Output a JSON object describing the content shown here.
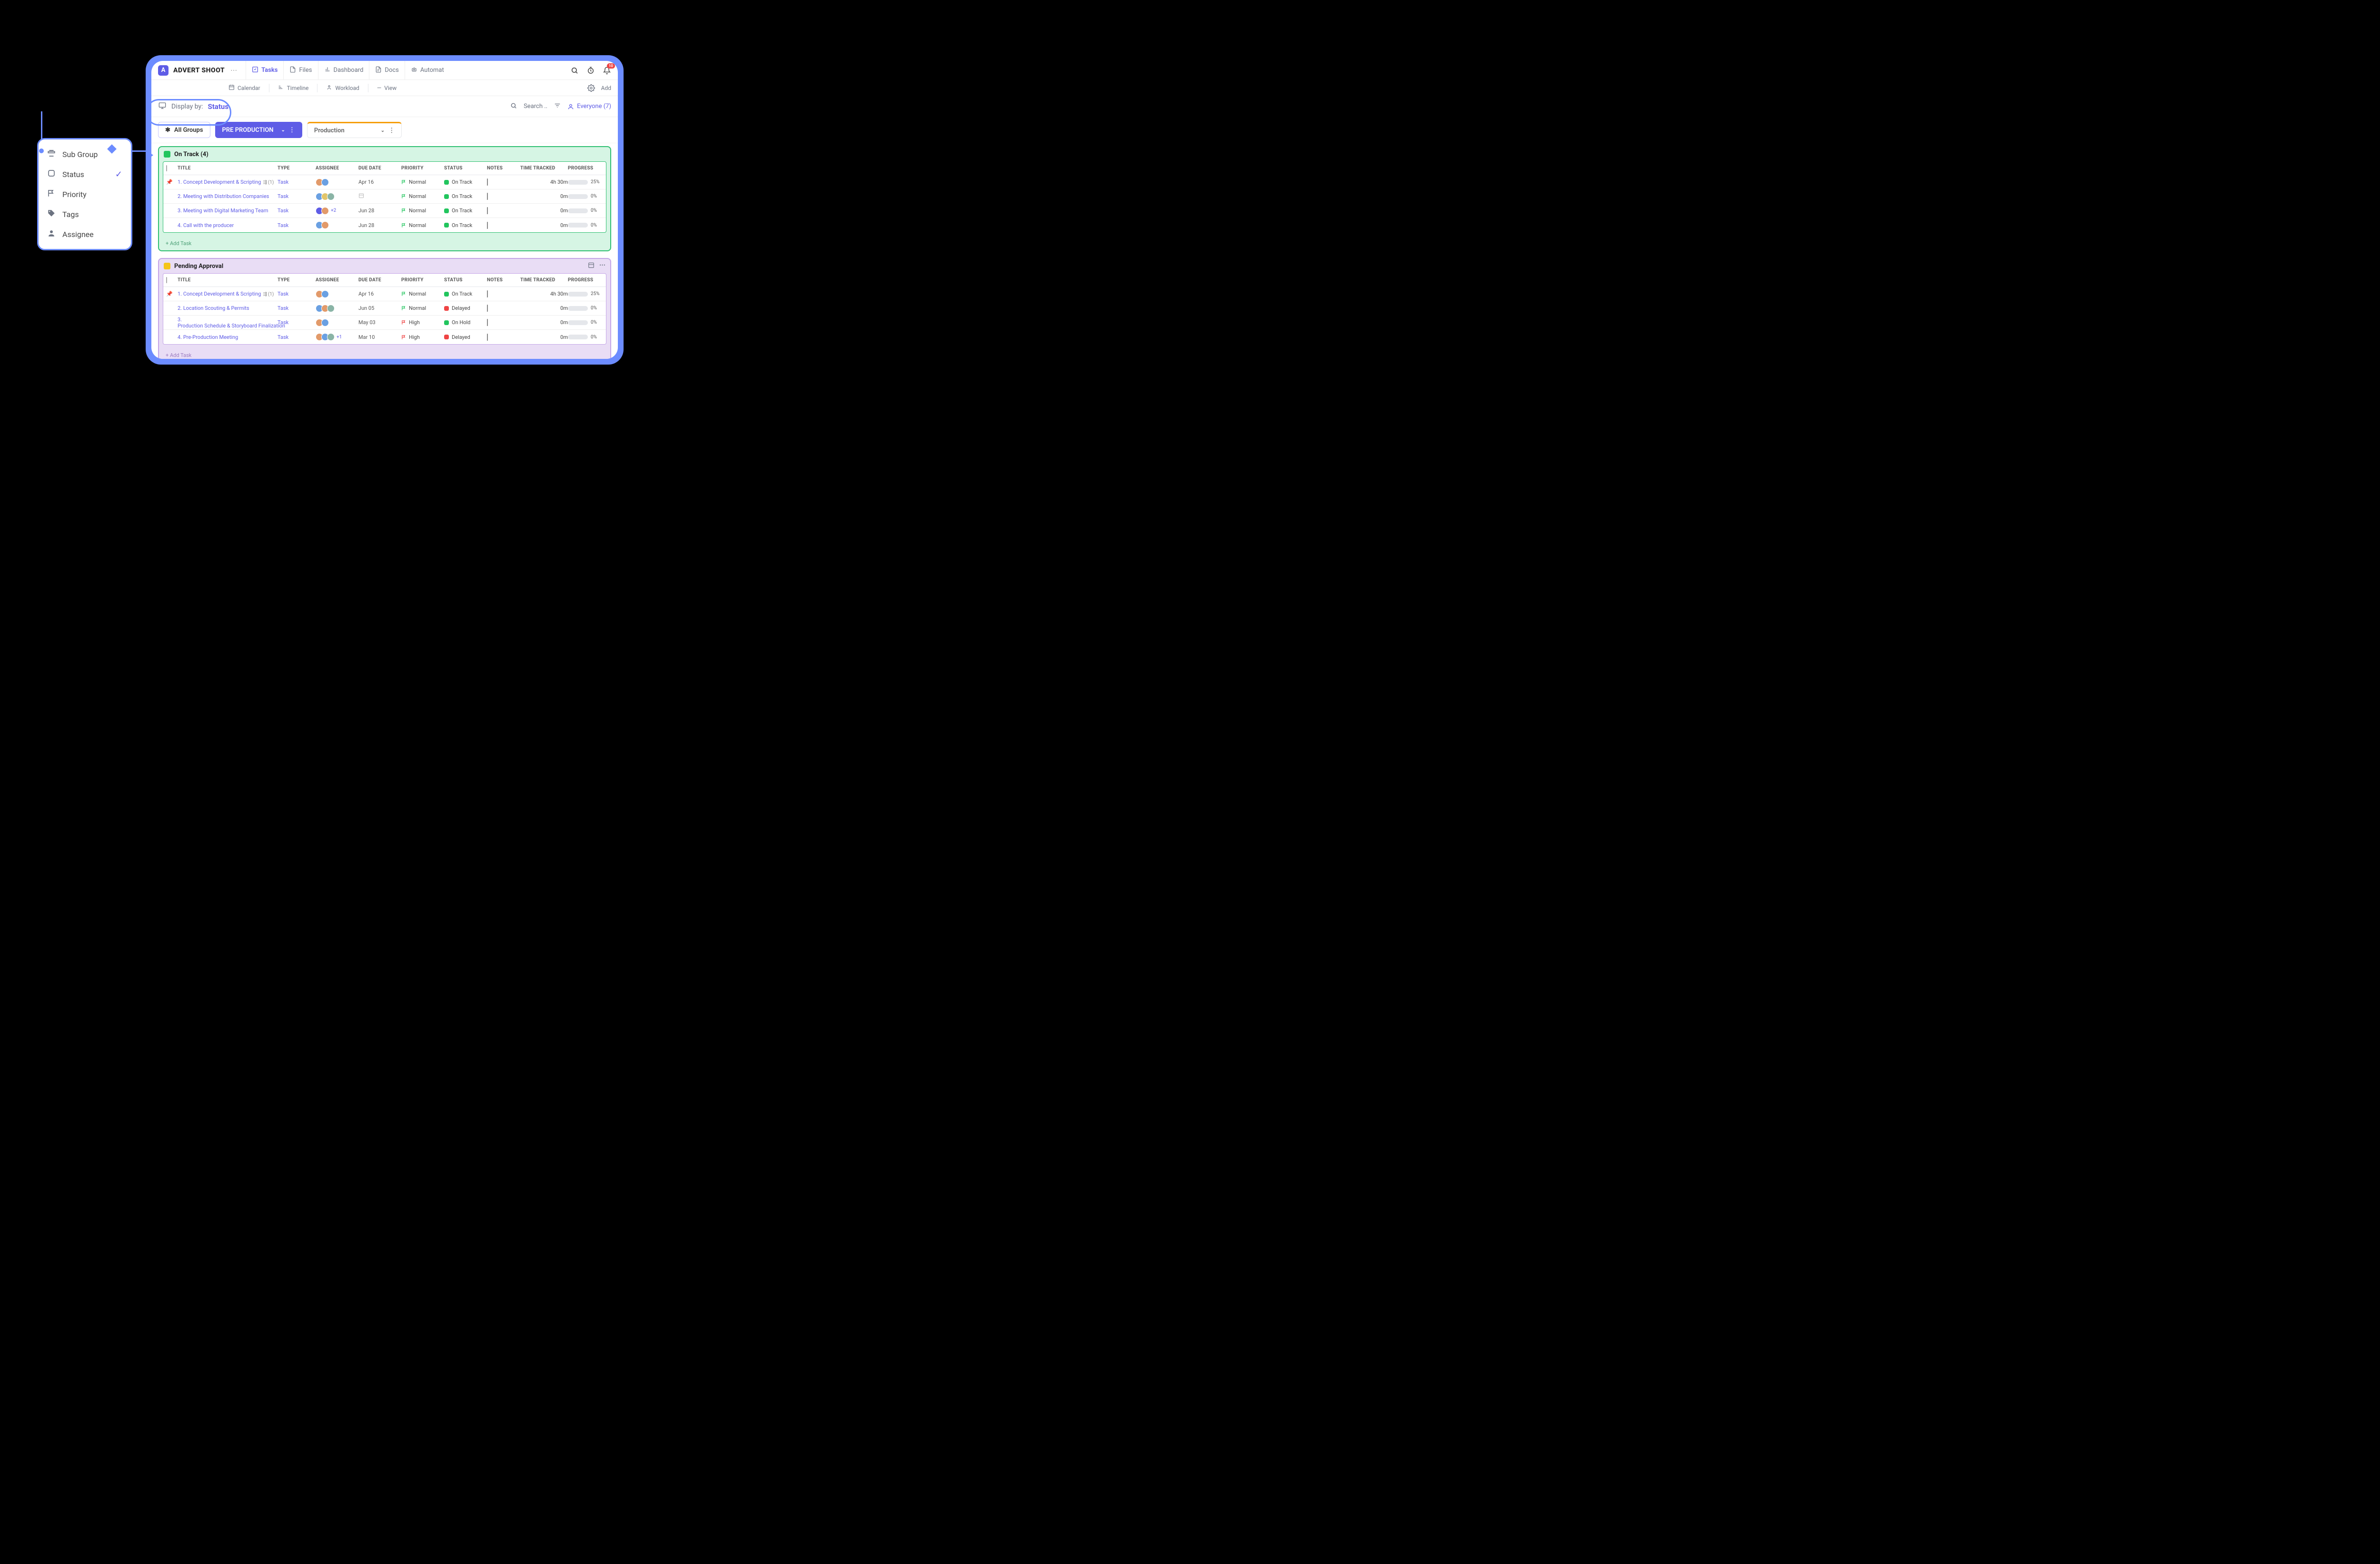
{
  "header": {
    "app_icon_letter": "A",
    "title": "ADVERT SHOOT",
    "tabs": [
      {
        "label": "Tasks",
        "icon": "checklist-icon",
        "active": true
      },
      {
        "label": "Files",
        "icon": "file-icon"
      },
      {
        "label": "Dashboard",
        "icon": "bar-chart-icon"
      },
      {
        "label": "Docs",
        "icon": "doc-icon"
      },
      {
        "label": "Automat",
        "icon": "robot-icon"
      }
    ],
    "notifications_count": "10"
  },
  "viewbar": {
    "items": [
      "Calendar",
      "Timeline",
      "Workload",
      "View"
    ],
    "add_label": "Add"
  },
  "displaybar": {
    "label": "Display by:",
    "value": "Status",
    "search_placeholder": "Search ..",
    "everyone_label": "Everyone (7)"
  },
  "popup": {
    "items": [
      {
        "label": "Sub Group",
        "icon": "subgroup-icon"
      },
      {
        "label": "Status",
        "icon": "status-icon",
        "checked": true
      },
      {
        "label": "Priority",
        "icon": "flag-icon"
      },
      {
        "label": "Tags",
        "icon": "tag-icon"
      },
      {
        "label": "Assignee",
        "icon": "person-icon"
      }
    ]
  },
  "group_tabs": {
    "all": "All Groups",
    "pre": "PRE PRODUCTION",
    "prod": "Production"
  },
  "columns": [
    "",
    "TITLE",
    "TYPE",
    "ASSIGNEE",
    "DUE DATE",
    "PRIORITY",
    "STATUS",
    "NOTES",
    "TIME TRACKED",
    "PROGRESS",
    ""
  ],
  "sections": [
    {
      "key": "ontrack",
      "title": "On Track (4)",
      "status_color": "#22c55e",
      "rows": [
        {
          "pinned": true,
          "num": "1.",
          "title": "Concept Development & Scripting",
          "has_subtask": true,
          "subcount": "(1)",
          "type": "Task",
          "assignees": [
            "#e29a6a",
            "#6aa0e2"
          ],
          "due": "Apr 16",
          "priority": {
            "label": "Normal",
            "color": "#22c55e"
          },
          "status": {
            "label": "On Track",
            "color": "#22c55e"
          },
          "time": "4h 30m",
          "progress": 25
        },
        {
          "num": "2.",
          "title": "Meeting with Distribution Companies",
          "type": "Task",
          "assignees": [
            "#6aa0e2",
            "#e2c56a",
            "#8ab4a6"
          ],
          "due": "",
          "priority": {
            "label": "Normal",
            "color": "#22c55e"
          },
          "status": {
            "label": "On Track",
            "color": "#22c55e"
          },
          "time": "0m",
          "progress": 0
        },
        {
          "num": "3.",
          "title": "Meeting with Digital Marketing Team",
          "type": "Task",
          "assignees": [
            "#5e5ce6",
            "#e29a6a"
          ],
          "extra": "+2",
          "due": "Jun 28",
          "priority": {
            "label": "Normal",
            "color": "#22c55e"
          },
          "status": {
            "label": "On Track",
            "color": "#22c55e"
          },
          "time": "0m",
          "progress": 0
        },
        {
          "num": "4.",
          "title": "Call with the producer",
          "type": "Task",
          "assignees": [
            "#6aa0e2",
            "#e29a6a"
          ],
          "due": "Jun 28",
          "priority": {
            "label": "Normal",
            "color": "#22c55e"
          },
          "status": {
            "label": "On Track",
            "color": "#22c55e"
          },
          "time": "0m",
          "progress": 0
        }
      ],
      "add_label": "+ Add Task"
    },
    {
      "key": "pending",
      "title": "Pending Approval",
      "status_color": "#f5c518",
      "rows": [
        {
          "pinned": true,
          "num": "1.",
          "title": "Concept Development & Scripting",
          "has_subtask": true,
          "subcount": "(1)",
          "type": "Task",
          "assignees": [
            "#e29a6a",
            "#6aa0e2"
          ],
          "due": "Apr 16",
          "priority": {
            "label": "Normal",
            "color": "#22c55e"
          },
          "status": {
            "label": "On Track",
            "color": "#22c55e"
          },
          "time": "4h 30m",
          "progress": 25
        },
        {
          "num": "2.",
          "title": "Location Scouting & Permits",
          "type": "Task",
          "assignees": [
            "#6aa0e2",
            "#e29a6a",
            "#8ab4a6"
          ],
          "due": "Jun 05",
          "priority": {
            "label": "Normal",
            "color": "#22c55e"
          },
          "status": {
            "label": "Delayed",
            "color": "#ef4444"
          },
          "time": "0m",
          "progress": 0
        },
        {
          "num": "3.",
          "title": "Production Schedule & Storyboard Finalization",
          "type": "Task",
          "assignees": [
            "#e29a6a",
            "#6aa0e2"
          ],
          "due": "May 03",
          "priority": {
            "label": "High",
            "color": "#ef4444"
          },
          "status": {
            "label": "On Hold",
            "color": "#22c55e"
          },
          "time": "0m",
          "progress": 0
        },
        {
          "num": "4.",
          "title": "Pre-Production Meeting",
          "type": "Task",
          "assignees": [
            "#e29a6a",
            "#6aa0e2",
            "#8ab4a6"
          ],
          "extra": "+1",
          "due": "Mar 10",
          "priority": {
            "label": "High",
            "color": "#ef4444"
          },
          "status": {
            "label": "Delayed",
            "color": "#ef4444"
          },
          "time": "0m",
          "progress": 0
        }
      ],
      "add_label": "+ Add Task"
    }
  ]
}
